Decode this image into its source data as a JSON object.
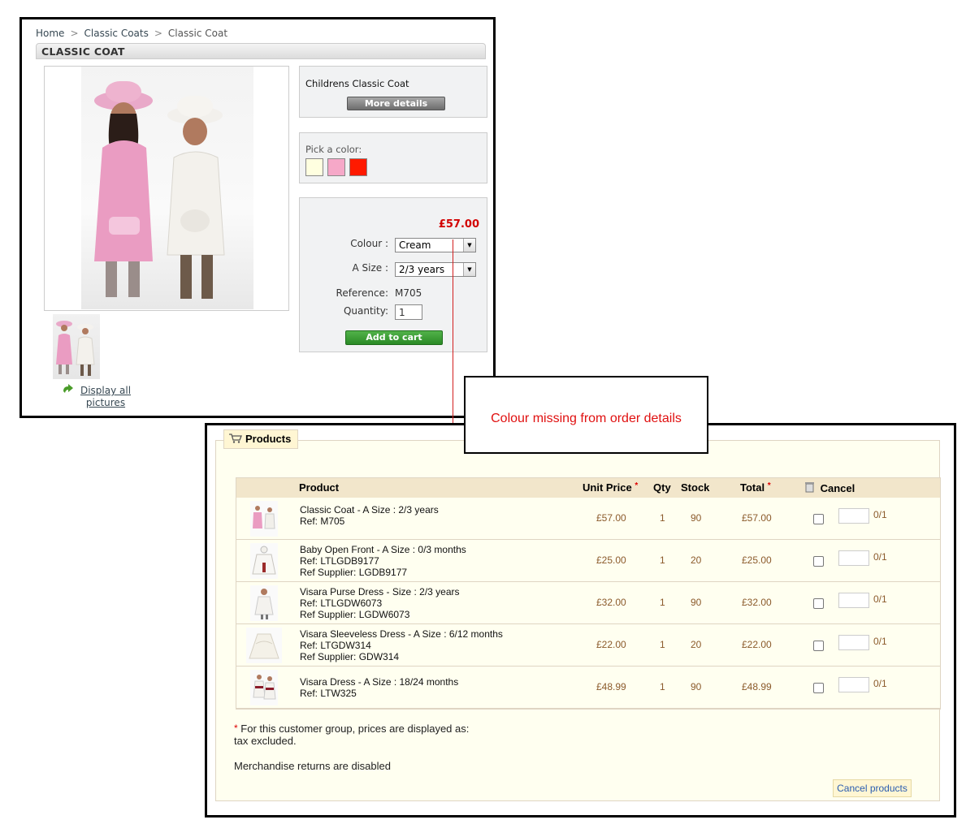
{
  "product_page": {
    "breadcrumb": [
      {
        "label": "Home"
      },
      {
        "label": "Classic Coats"
      },
      {
        "label": "Classic Coat"
      }
    ],
    "breadcrumb_separator": ">",
    "title": "CLASSIC COAT",
    "description": "Childrens Classic Coat",
    "more_details_label": "More details",
    "pick_color_label": "Pick a color:",
    "color_swatches": [
      "#ffffe0",
      "#f6a8c8",
      "#ff1a00"
    ],
    "price": "£57.00",
    "colour_label": "Colour :",
    "colour_value": "Cream",
    "size_label": "A Size :",
    "size_value": "2/3 years",
    "reference_label": "Reference:",
    "reference_value": "M705",
    "quantity_label": "Quantity:",
    "quantity_value": "1",
    "add_to_cart_label": "Add to cart",
    "display_all_label": "Display all pictures"
  },
  "callout": {
    "text": "Colour missing from order details"
  },
  "order": {
    "legend": "Products",
    "columns": {
      "product": "Product",
      "unit_price": "Unit Price",
      "qty": "Qty",
      "stock": "Stock",
      "total": "Total",
      "cancel": "Cancel"
    },
    "rows": [
      {
        "lines": [
          "Classic Coat - A Size : 2/3 years",
          "Ref: M705"
        ],
        "unit_price": "£57.00",
        "qty": "1",
        "stock": "90",
        "total": "£57.00",
        "cancel_of": "0/1"
      },
      {
        "lines": [
          "Baby Open Front - A Size : 0/3 months",
          "Ref: LTLGDB9177",
          "Ref Supplier: LGDB9177"
        ],
        "unit_price": "£25.00",
        "qty": "1",
        "stock": "20",
        "total": "£25.00",
        "cancel_of": "0/1"
      },
      {
        "lines": [
          "Visara Purse Dress - Size : 2/3 years",
          "Ref: LTLGDW6073",
          "Ref Supplier: LGDW6073"
        ],
        "unit_price": "£32.00",
        "qty": "1",
        "stock": "90",
        "total": "£32.00",
        "cancel_of": "0/1"
      },
      {
        "lines": [
          "Visara Sleeveless Dress - A Size : 6/12 months",
          "Ref: LTGDW314",
          "Ref Supplier: GDW314"
        ],
        "unit_price": "£22.00",
        "qty": "1",
        "stock": "20",
        "total": "£22.00",
        "cancel_of": "0/1"
      },
      {
        "lines": [
          "Visara Dress - A Size : 18/24 months",
          "Ref: LTW325"
        ],
        "unit_price": "£48.99",
        "qty": "1",
        "stock": "90",
        "total": "£48.99",
        "cancel_of": "0/1"
      }
    ],
    "tax_note": "For this customer group, prices are displayed as: tax excluded.",
    "returns_note": "Merchandise returns are disabled",
    "cancel_button_label": "Cancel products"
  }
}
